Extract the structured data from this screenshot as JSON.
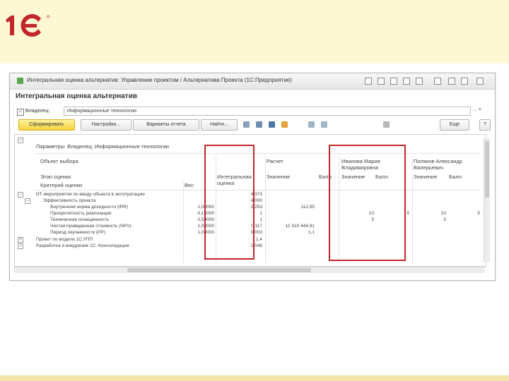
{
  "brand": {
    "logo_text": "1С",
    "registered_mark": "®"
  },
  "window": {
    "title": "Интегральная оценка альтернатив: Управление проектом  / Альтернатива Проекта (1С:Предприятие)",
    "form_title": "Интегральная оценка альтернатив",
    "owner_label": "Владелец:",
    "owner_value": "Информационные технологии",
    "owner_buttons": "...  ×"
  },
  "toolbar": {
    "generate": "Сформировать",
    "settings": "Настройки...",
    "variants": "Варианты отчета",
    "find": "Найти...",
    "more": "Еще",
    "help": "?"
  },
  "report": {
    "params_line": "Параметры:  Владелец: Информационные технологии",
    "object_label": "Объект выбора",
    "stage_label": "Этап оценки",
    "criteria_label": "Критерий оценки",
    "weight_label": "Вес",
    "integral_label": "Интегральная оценка",
    "report_label": "Расчет",
    "value_label": "Значение",
    "score_label": "Балл",
    "expert1": "Иванова Мария Владимировна",
    "expert2": "Поляков Александр Валерьевич",
    "rows": [
      {
        "name": "ИТ-мероприятия по вводу объекта в эксплуатацию",
        "weight": "",
        "integral": "4,373",
        "value": "",
        "score": "",
        "e1v": "",
        "e1s": "",
        "e2v": "",
        "e2s": ""
      },
      {
        "name": "Эффективность проекта",
        "weight": "",
        "integral": "4,000",
        "value": "",
        "score": "",
        "e1v": "",
        "e1s": "",
        "e2v": "",
        "e2s": ""
      },
      {
        "name": "Внутренняя норма доходности (IRR)",
        "weight": "1,00000",
        "integral": "2,253",
        "value": "112,55",
        "score": "",
        "e1v": "",
        "e1s": "",
        "e2v": "",
        "e2s": ""
      },
      {
        "name": "Приоритетность реализации",
        "weight": "0,15000",
        "integral": "1",
        "value": "",
        "score": "",
        "e1v": "10",
        "e1s": "5",
        "e2v": "10",
        "e2s": "5"
      },
      {
        "name": "Техническая оснащенность",
        "weight": "0,50000",
        "integral": "1",
        "value": "",
        "score": "",
        "e1v": "5",
        "e1s": "",
        "e2v": "5",
        "e2s": ""
      },
      {
        "name": "Чистая приведенная стоимость (NPV)",
        "weight": "1,00000",
        "integral": "0,117",
        "value": "11 510 444,91",
        "score": "",
        "e1v": "",
        "e1s": "",
        "e2v": "",
        "e2s": ""
      },
      {
        "name": "Период окупаемости (PP)",
        "weight": "1,00000",
        "integral": "0,003",
        "value": "1,1",
        "score": "",
        "e1v": "",
        "e1s": "",
        "e2v": "",
        "e2s": ""
      },
      {
        "name": "Проект по модели 1С:УПП",
        "weight": "",
        "integral": "1,4",
        "value": "",
        "score": "",
        "e1v": "",
        "e1s": "",
        "e2v": "",
        "e2s": ""
      },
      {
        "name": "Разработка и внедрение 1С: Консолидация",
        "weight": "",
        "integral": "1,048",
        "value": "",
        "score": "",
        "e1v": "",
        "e1s": "",
        "e2v": "",
        "e2s": ""
      }
    ]
  },
  "colors": {
    "brand_red": "#c0282a",
    "banner": "#fdf7d4",
    "primary_button": "#f5d33c"
  }
}
